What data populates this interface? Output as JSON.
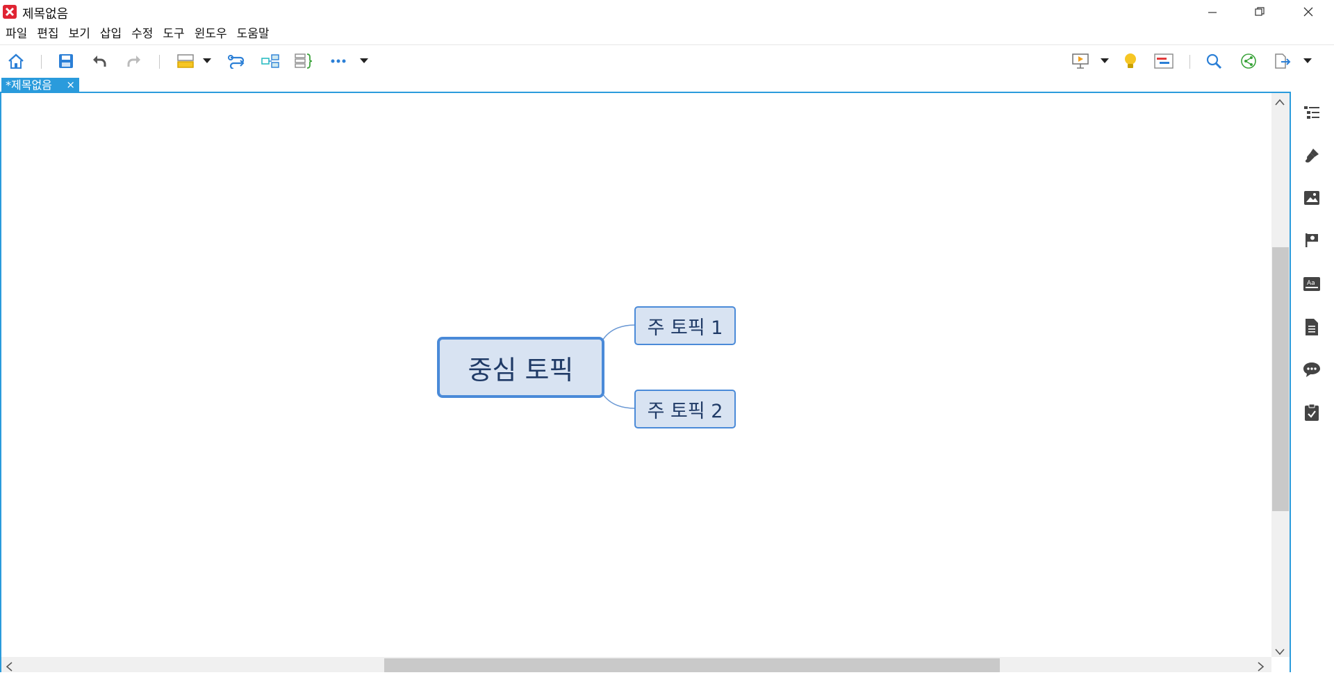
{
  "window": {
    "title": "제목없음"
  },
  "menu": [
    "파일",
    "편집",
    "보기",
    "삽입",
    "수정",
    "도구",
    "윈도우",
    "도움말"
  ],
  "toolbar": {
    "left": [
      "home-icon",
      "save-icon",
      "undo-icon",
      "redo-icon",
      "topic-icon",
      "relationship-icon",
      "summary-icon",
      "boundary-icon",
      "more-icon"
    ],
    "right": [
      "presentation-icon",
      "lightbulb-icon",
      "gantt-icon",
      "search-icon",
      "share-icon",
      "export-icon"
    ]
  },
  "tab": {
    "label": "*제목없음",
    "close": "×"
  },
  "mindmap": {
    "central": "중심 토픽",
    "topics": [
      "주 토픽 1",
      "주 토픽 2"
    ]
  },
  "sidebar": [
    "outline-icon",
    "format-brush-icon",
    "image-icon",
    "marker-flag-icon",
    "text-style-icon",
    "notes-icon",
    "comment-icon",
    "task-icon"
  ],
  "colors": {
    "accent": "#2a9bdc",
    "topic_fill": "#d8e3f2",
    "topic_border": "#4a8ad8",
    "logo": "#e02433"
  }
}
